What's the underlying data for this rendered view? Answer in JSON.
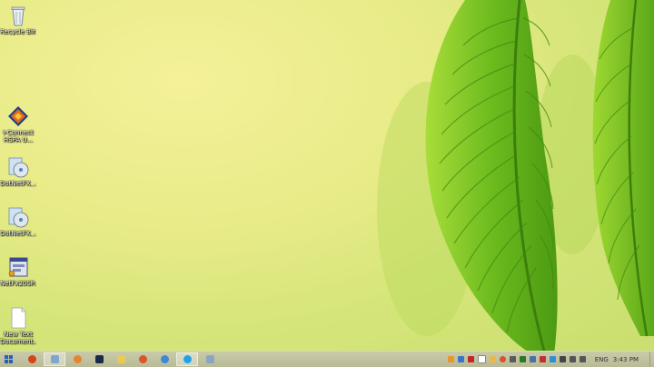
{
  "desktop": {
    "icons": [
      {
        "label": "Recycle Bin",
        "icon": "recycle-bin-icon"
      },
      {
        "label": "I-Connect HSPA U...",
        "icon": "i-connect-app-icon"
      },
      {
        "label": "DotNetFX_...",
        "icon": "installer-disc-icon"
      },
      {
        "label": "DotNetFX_...",
        "icon": "installer-disc-icon"
      },
      {
        "label": "NetFx20SP...",
        "icon": "setup-package-icon"
      },
      {
        "label": "New Text Document...",
        "icon": "text-document-icon"
      }
    ]
  },
  "taskbar": {
    "apps": [
      "internet-explorer-icon",
      "file-explorer-icon",
      "firefox-icon",
      "media-player-icon",
      "folder-icon",
      "chat-icon",
      "browser-icon",
      "skype-icon",
      "settings-icon"
    ],
    "tray": {
      "language": "ENG",
      "time": "3:43 PM"
    }
  },
  "colors": {
    "wallpaper": "#e7eb86",
    "leaf": "#7cc62e",
    "taskbar": "#c4c6a3"
  }
}
